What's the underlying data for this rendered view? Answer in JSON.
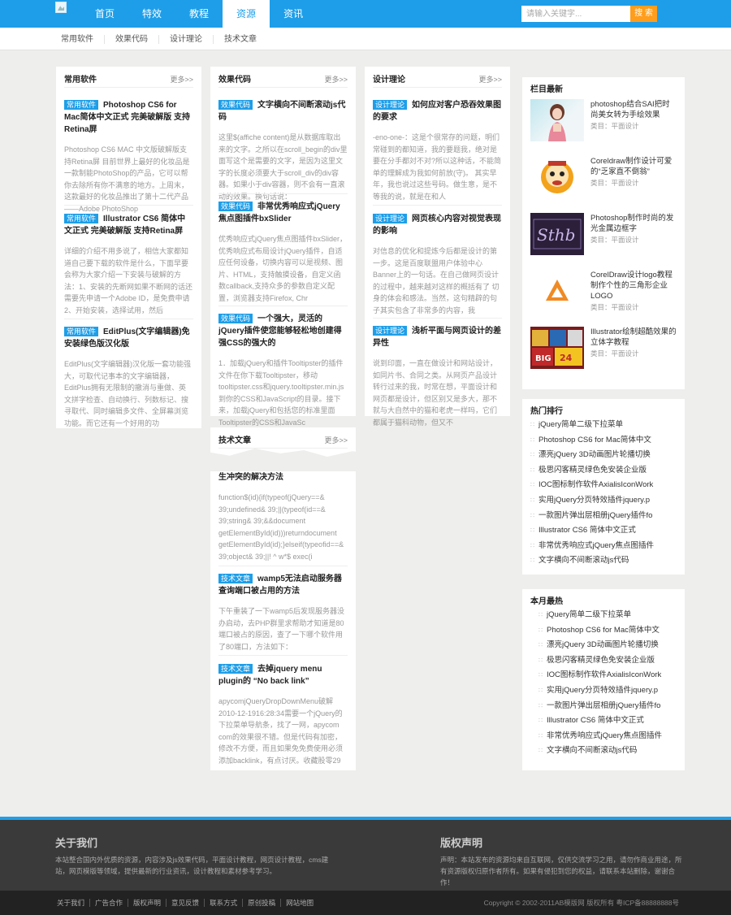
{
  "nav": {
    "items": [
      "首页",
      "特效",
      "教程",
      "资源",
      "资讯"
    ],
    "active_index": 3
  },
  "search": {
    "placeholder": "请输入关键字...",
    "button": "搜 索"
  },
  "subnav": [
    "常用软件",
    "效果代码",
    "设计理论",
    "技术文章"
  ],
  "more_label": "更多>>",
  "columns": {
    "software": {
      "title": "常用软件",
      "posts": [
        {
          "tag": "常用软件",
          "title": "Photoshop CS6 for Mac简体中文正式 完美破解版 支持Retina屏",
          "summary": "Photoshop CS6 MAC 中文版破解版支持Retina屏 目前世界上最好的化妆品是一款制能PhotoShop的产品，它可以帮你去除所有你不满意的地方。上周末，这款最好的化妆品推出了第十二代产品——Adobe PhotoShop"
        },
        {
          "tag": "常用软件",
          "title": "Illustrator CS6 简体中文正式 完美破解版 支持Retina屏",
          "summary": "详细的介绍不用多说了，相信大家都知道自己要下载的软件是什么，下面早要会称为大家介绍一下安装与破解的方法：1、安装的先断网如果不断网的话还需要先申请一个Adobe ID，是免费申请2、开始安装，选择试用，然后"
        },
        {
          "tag": "常用软件",
          "title": "EditPlus(文字编辑器)免安装绿色版汉化版",
          "summary": "EditPlus(文字编辑器)汉化版一套功能强大，可取代记事本的文字编辑器，EditPlus拥有无限制的撤消与重做、英文拼字检查、自动换行、列数标记、搜寻取代、同时编辑多文件、全屏幕浏览功能。而它还有一个好用的功"
        }
      ]
    },
    "code": {
      "title": "效果代码",
      "posts": [
        {
          "tag": "效果代码",
          "title": "文字横向不间断滚动js代码",
          "summary": "这里$(affiche content)是从数据库取出来的文字。之所以在scroll_begin的div里面写这个是需要的文字，是因为这里文字的长度必须要大于scroll_div的div容器。如果小于div容器，则不会有一直滚动的效果。换句话说："
        },
        {
          "tag": "效果代码",
          "title": "非常优秀响应式jQuery焦点图插件bxSlider",
          "summary": "优秀响应式jQuery焦点图插件bxSlider，优秀响应式布局设计jQuery插件，自适应任何设备，切换内容可以是视频、图片、HTML，支持触摸设备，自定义函数callback,支持众多的参数自定义配置，浏览器支持Firefox, Chr"
        },
        {
          "tag": "效果代码",
          "title": "一个强大，灵活的jQuery插件使您能够轻松地创建得强CSS的强大的",
          "summary": "1．加载jQuery和插件Tooltipster的插件文件在你下载Tooltipster，移动tooltipster.css和jquery.tooltipster.min.js到你的CSS和JavaScript的目录。接下来，加载jQuery和包括您的标准里面Tooltipster的CSS和JavaSc"
        }
      ]
    },
    "theory": {
      "title": "设计理论",
      "posts": [
        {
          "tag": "设计理论",
          "title": "如何应对客户恐吞效果图的要求",
          "summary": "-eno-one-：这是个很常存的问题，明们常碰到的都知道，我的要题我，绝对是要在分手都対不对?所以这种话，不能简单的理解成为我如何前放(守)。 其实早年，我也说过这些号码。做生意，是不等我的说，就是在和人"
        },
        {
          "tag": "设计理论",
          "title": "网页核心内容对视觉表现的影响",
          "summary": "对信息的优化和提炼今后都是设计的第一步。这是百度联盟用户体验中心Banner上的一句话。在自己做网页设计的过程中，越来越对这样的概括有了 切身的体会和感法。当然，这句精辟的句子其实包含了非常多的内容，我"
        },
        {
          "tag": "设计理论",
          "title": "浅析平面与网页设计的差异性",
          "summary": "说到印面，一直在做设计和网站设计，如同片书、合同之类。从网页产品设计转行过来的我，时常在想，平面设计和网页都是设计，但区别又是多大，那不就与大自然中的猫和老虎一样吗，它们都属于猫科动物，但又不"
        }
      ]
    },
    "tech": {
      "title": "技术文章",
      "posts": [
        {
          "tag": "",
          "title": "生冲突的解决方法",
          "summary": "function$(id){if(typeof(jQuery==& 39;undefined& 39;||(typeof(id==& 39;string& 39;&&document getElementById(id)))returndocument getElementById(id);}elseif(typeofid==& 39;object& 39;||! ^ w*$ exec(i"
        },
        {
          "tag": "技术文章",
          "title": "wamp5无法启动服务器 查询端口被占用的方法",
          "summary": "下午重装了一下wamp5后发现服务器没办启动，去PHP群里求帮助才知道是80端口被占的原因，查了一下哪个软件用了80端口，方法如下："
        },
        {
          "tag": "技术文章",
          "title": "去掉jquery menu plugin的 “No back link”",
          "summary": "apycomjQueryDropDownMenu破解2010-12-1916:28:34需要一个jQuery的下拉菜单导航条，找了一网，apycom com的效果很不错。但是代码有加密，修改不方便，而且如果免免费使用必须添加backlink，有点讨厌。收藏股零29"
        }
      ]
    }
  },
  "latest": {
    "title": "栏目最新",
    "items": [
      {
        "title": "photoshop结合SAI把时尚美女转为手绘效果",
        "cat": "类目：平面设计"
      },
      {
        "title": "Coreldraw制作设计可爱的“乏家直不倒翁”",
        "cat": "类目：平面设计"
      },
      {
        "title": "Photoshop制作时尚的发光金属边框字",
        "cat": "类目：平面设计"
      },
      {
        "title": "CorelDraw设计logo教程制作个性的三角形企业LOGO",
        "cat": "类目：平面设计"
      },
      {
        "title": "Illustrator绘制超酷效果的立体字教程",
        "cat": "类目：平面设计"
      }
    ]
  },
  "hot": {
    "title": "热门排行",
    "items": [
      "jQuery简单二级下拉菜单",
      "Photoshop CS6 for Mac简体中文",
      "漂亮jQuery 3D动画图片轮播切换",
      "极思闪客精灵绿色免安装企业版",
      "IOC图标制作软件AxialisIconWork",
      "实用jQuery分页特效插件jquery.p",
      "一款图片弹出层相册jQuery插件fo",
      "Illustrator CS6 简体中文正式",
      "非常优秀响应式jQuery焦点图插件",
      "文字横向不间断滚动js代码"
    ]
  },
  "month": {
    "title": "本月最热",
    "items": [
      "jQuery简单二级下拉菜单",
      "Photoshop CS6 for Mac简体中文",
      "漂亮jQuery 3D动画图片轮播切换",
      "极思闪客精灵绿色免安装企业版",
      "IOC图标制作软件AxialisIconWork",
      "实用jQuery分页特效插件jquery.p",
      "一款图片弹出层相册jQuery插件fo",
      "Illustrator CS6 简体中文正式",
      "非常优秀响应式jQuery焦点图插件",
      "文字横向不间断滚动js代码"
    ]
  },
  "footer": {
    "about_title": "关于我们",
    "about_text": "本站整合国内外优质的资源，内容涉及js效果代码，平面设计教程，网页设计教程，cms建站，网页模版等领域，提供最新的行业资讯，设计教程和素材参考学习。",
    "copyright_title": "版权声明",
    "copyright_text": "声明：本站发布的资源均来自互联网，仅供交流学习之用，请勿作商业用途，所有资源版权归原作者所有。如果有侵犯到您的权益，请联系本站删除，谢谢合作！",
    "links": [
      "关于我们",
      "广告合作",
      "版权声明",
      "意见反馈",
      "联系方式",
      "原创投稿",
      "网站地图"
    ],
    "copy": "Copyright © 2002-2011AB模版网 版权所有  粤ICP备88888888号"
  },
  "colors": {
    "brand": "#1e9ee8",
    "search_button": "#ff9d1c",
    "footer": "#3a3a3a"
  }
}
